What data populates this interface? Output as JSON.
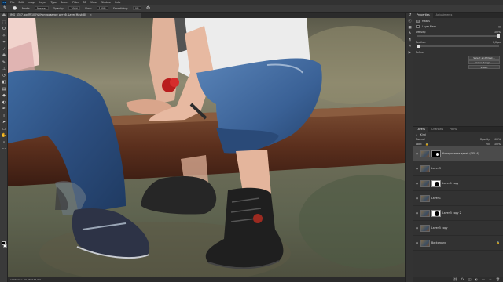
{
  "menubar": {
    "logo": "Ps",
    "items": [
      "File",
      "Edit",
      "Image",
      "Layer",
      "Type",
      "Select",
      "Filter",
      "3D",
      "View",
      "Window",
      "Help"
    ]
  },
  "options": {
    "mode_label": "Mode:",
    "mode_value": "Normal",
    "opacity_label": "Opacity:",
    "opacity_value": "100%",
    "flow_label": "Flow:",
    "flow_value": "100%",
    "smoothing_label": "Smoothing:",
    "smoothing_value": "0%"
  },
  "document": {
    "tab_title": "IMG_4357.jpg @ 100% (Копирование детей, Layer Mask/8)",
    "status": "100%   Doc: 15,4M/174,6M"
  },
  "properties": {
    "tabs": [
      "Properties",
      "Adjustments"
    ],
    "section": "Masks",
    "layer_mask": "Layer Mask",
    "density_label": "Density:",
    "density_value": "100%",
    "feather_label": "Feather:",
    "feather_value": "0,0 px",
    "refine_label": "Refine:",
    "buttons": [
      "Select and Mask...",
      "Color Range...",
      "Invert"
    ]
  },
  "layers_panel": {
    "tabs": [
      "Layers",
      "Channels",
      "Paths"
    ],
    "filter_kind": "Kind",
    "blend_mode": "Normal",
    "opacity_label": "Opacity:",
    "opacity_value": "100%",
    "lock_label": "Lock:",
    "fill_label": "Fill:",
    "fill_value": "100%",
    "rows": [
      {
        "name": "Копирование детей (ОБР 4)",
        "mask": "black"
      },
      {
        "name": "Layer 3",
        "mask": "none"
      },
      {
        "name": "Layer 1 copy",
        "mask": "white"
      },
      {
        "name": "Layer 1",
        "mask": "none"
      },
      {
        "name": "Layer 5 copy 2",
        "mask": "white"
      },
      {
        "name": "Layer 5 copy",
        "mask": "none"
      },
      {
        "name": "Background",
        "mask": "none"
      }
    ]
  }
}
